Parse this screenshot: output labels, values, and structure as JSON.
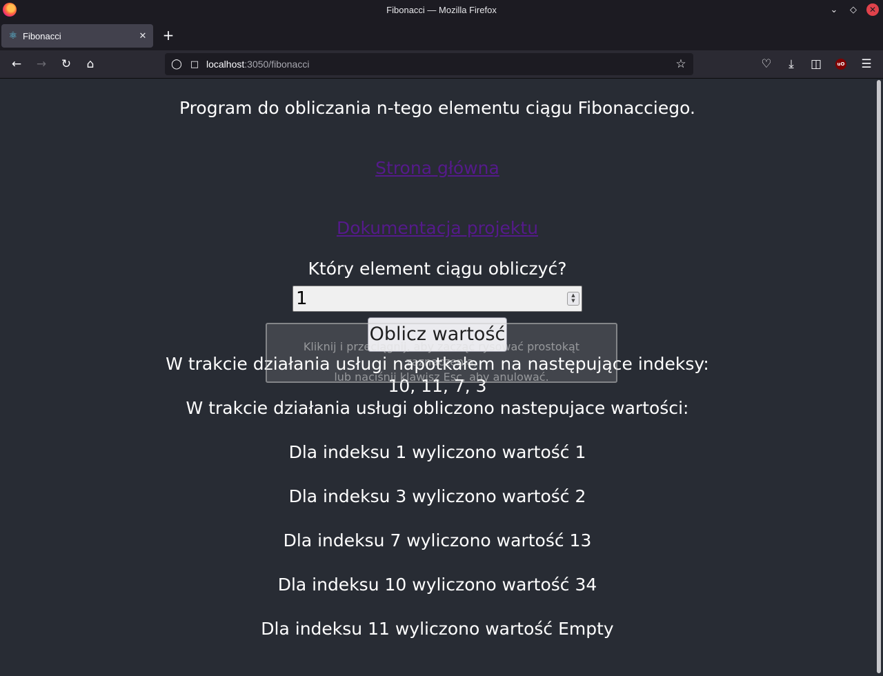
{
  "window": {
    "title": "Fibonacci — Mozilla Firefox"
  },
  "tabs": [
    {
      "label": "Fibonacci",
      "icon": "react-icon"
    }
  ],
  "navbar": {
    "url_host": "localhost",
    "url_path": ":3050/fibonacci"
  },
  "page": {
    "heading": "Program do obliczania n-tego elementu ciągu Fibonacciego.",
    "link_home": "Strona główna",
    "link_docs": "Dokumentacja projektu",
    "prompt": "Który element ciągu obliczyć?",
    "input_value": "1",
    "calc_button": "Oblicz wartość",
    "indexes_heading": "W trakcie działania usługi napotkałem na następujące indeksy:",
    "indexes_value": "10, 11, 7, 3",
    "values_heading": "W trakcie działania usługi obliczono nastepujace wartości:",
    "results": [
      "Dla indeksu 1 wyliczono wartość 1",
      "Dla indeksu 3 wyliczono wartość 2",
      "Dla indeksu 7 wyliczono wartość 13",
      "Dla indeksu 10 wyliczono wartość 34",
      "Dla indeksu 11 wyliczono wartość Empty"
    ]
  },
  "screenshot_overlay": {
    "line1": "Kliknij i przeciągnij, aby zacząć rysować prostokąt zaznaczenia,",
    "line2": "lub naciśnij klawisz Esc, aby anulować."
  }
}
